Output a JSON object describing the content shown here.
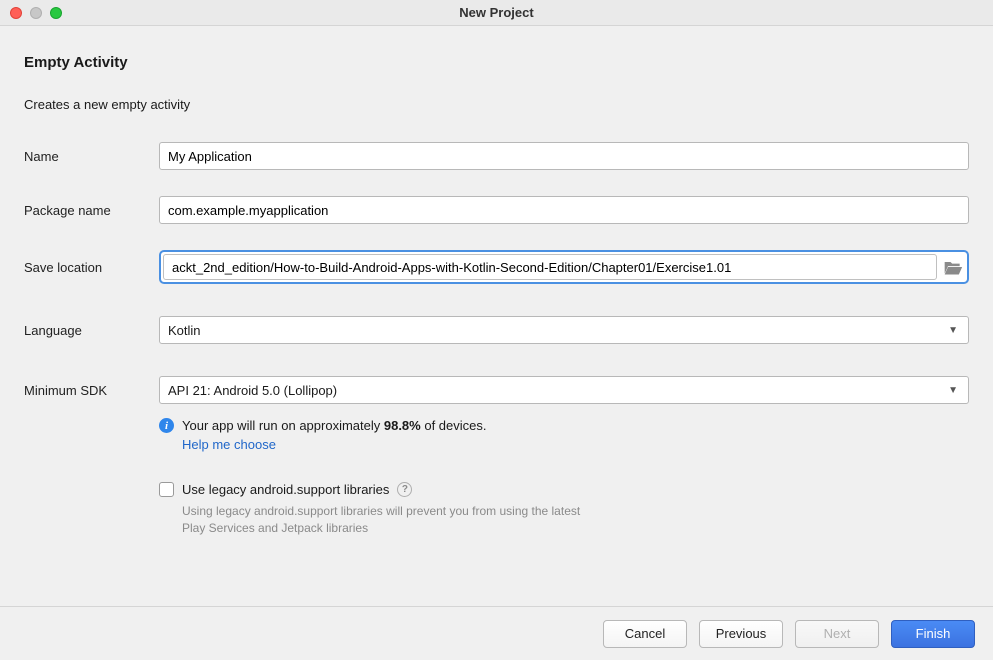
{
  "window": {
    "title": "New Project"
  },
  "header": {
    "heading": "Empty Activity",
    "subheading": "Creates a new empty activity"
  },
  "form": {
    "name": {
      "label": "Name",
      "value": "My Application"
    },
    "package": {
      "label": "Package name",
      "value": "com.example.myapplication"
    },
    "save_location": {
      "label": "Save location",
      "value": "ackt_2nd_edition/How-to-Build-Android-Apps-with-Kotlin-Second-Edition/Chapter01/Exercise1.01"
    },
    "language": {
      "label": "Language",
      "value": "Kotlin"
    },
    "min_sdk": {
      "label": "Minimum SDK",
      "value": "API 21: Android 5.0 (Lollipop)"
    }
  },
  "sdk_info": {
    "prefix": "Your app will run on approximately ",
    "percent": "98.8%",
    "suffix": " of devices.",
    "help_link": "Help me choose"
  },
  "legacy": {
    "checkbox_label": "Use legacy android.support libraries",
    "note": "Using legacy android.support libraries will prevent you from using the latest Play Services and Jetpack libraries",
    "checked": false
  },
  "buttons": {
    "cancel": "Cancel",
    "previous": "Previous",
    "next": "Next",
    "finish": "Finish"
  }
}
